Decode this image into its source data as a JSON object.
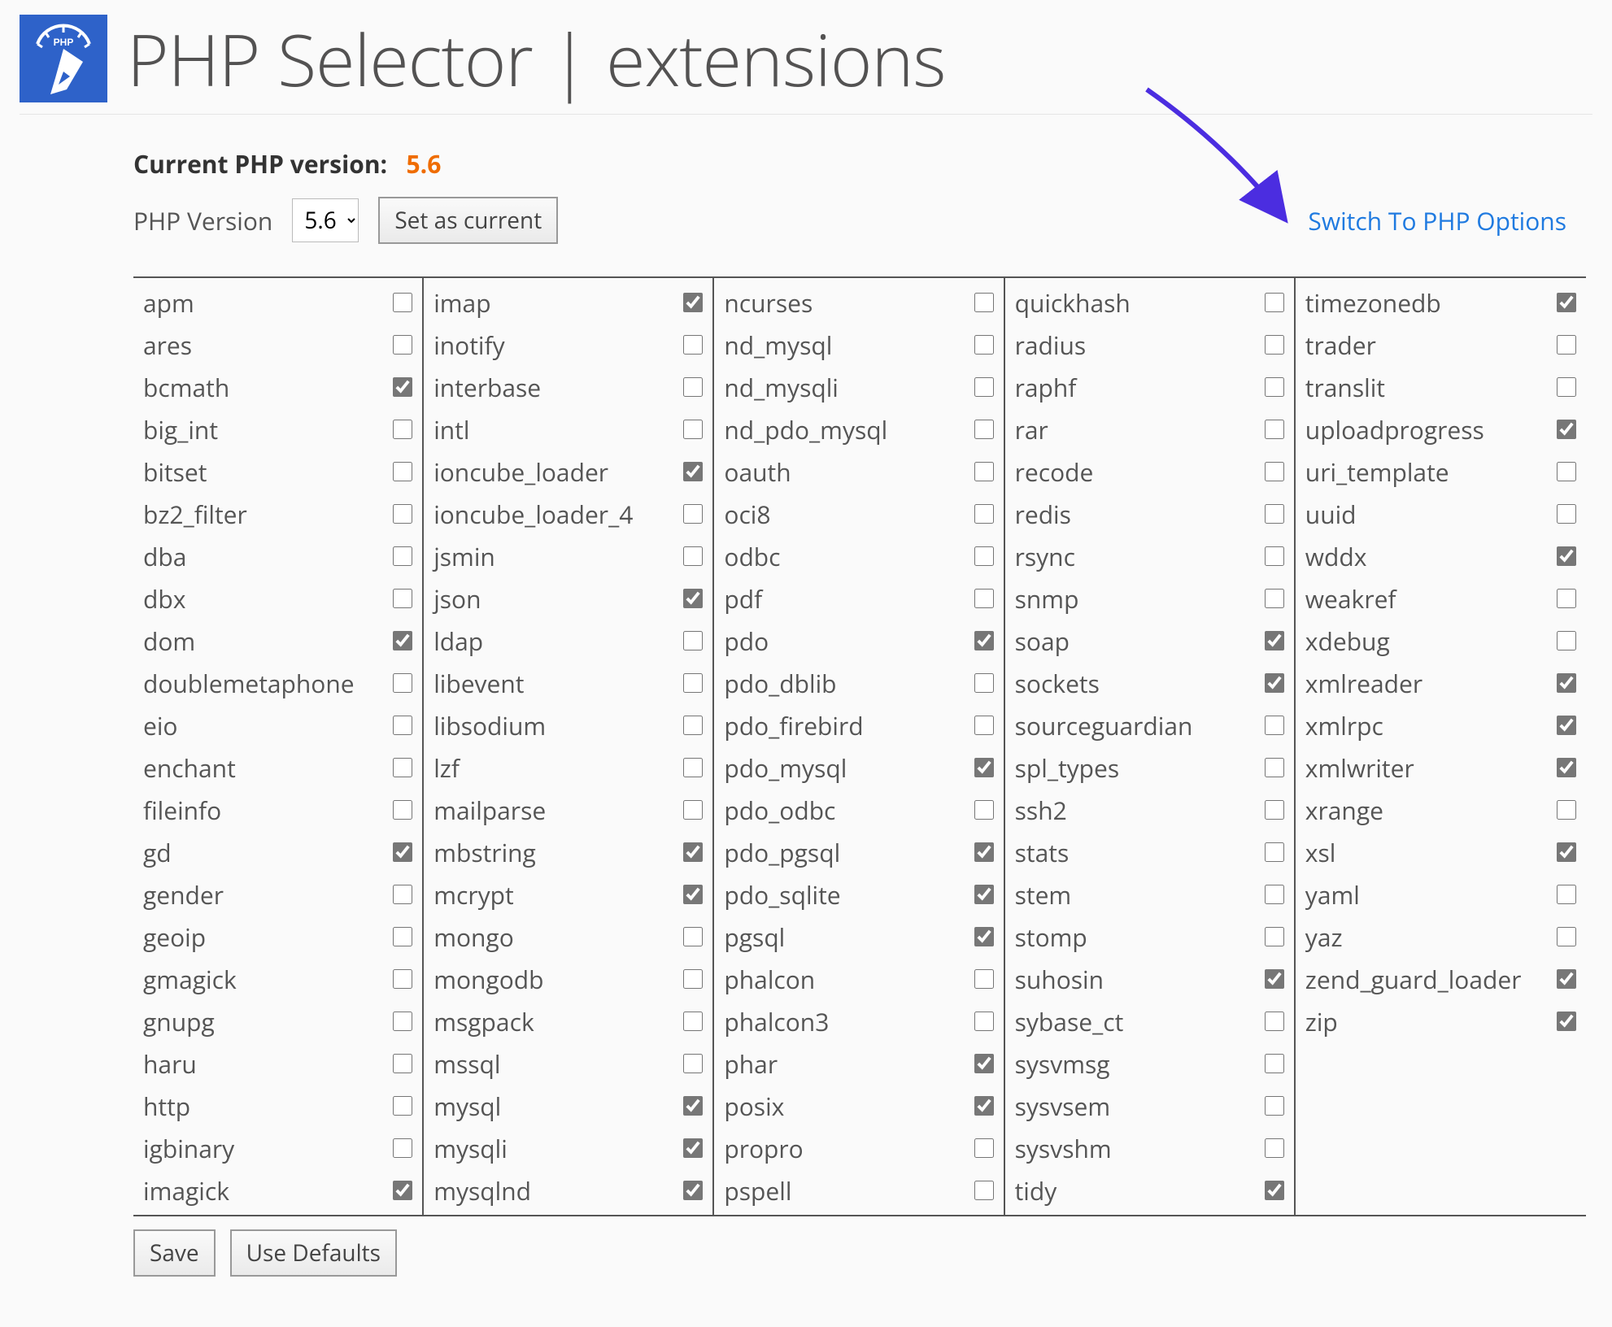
{
  "header": {
    "title": "PHP Selector | extensions"
  },
  "current": {
    "label": "Current PHP version:",
    "value": "5.6"
  },
  "versionRow": {
    "label": "PHP Version",
    "selected": "5.6",
    "setButton": "Set as current"
  },
  "switchLink": "Switch To PHP Options",
  "columns": [
    [
      {
        "name": "apm",
        "checked": false
      },
      {
        "name": "ares",
        "checked": false
      },
      {
        "name": "bcmath",
        "checked": true
      },
      {
        "name": "big_int",
        "checked": false
      },
      {
        "name": "bitset",
        "checked": false
      },
      {
        "name": "bz2_filter",
        "checked": false
      },
      {
        "name": "dba",
        "checked": false
      },
      {
        "name": "dbx",
        "checked": false
      },
      {
        "name": "dom",
        "checked": true
      },
      {
        "name": "doublemetaphone",
        "checked": false
      },
      {
        "name": "eio",
        "checked": false
      },
      {
        "name": "enchant",
        "checked": false
      },
      {
        "name": "fileinfo",
        "checked": false
      },
      {
        "name": "gd",
        "checked": true
      },
      {
        "name": "gender",
        "checked": false
      },
      {
        "name": "geoip",
        "checked": false
      },
      {
        "name": "gmagick",
        "checked": false
      },
      {
        "name": "gnupg",
        "checked": false
      },
      {
        "name": "haru",
        "checked": false
      },
      {
        "name": "http",
        "checked": false
      },
      {
        "name": "igbinary",
        "checked": false
      },
      {
        "name": "imagick",
        "checked": true
      }
    ],
    [
      {
        "name": "imap",
        "checked": true
      },
      {
        "name": "inotify",
        "checked": false
      },
      {
        "name": "interbase",
        "checked": false
      },
      {
        "name": "intl",
        "checked": false
      },
      {
        "name": "ioncube_loader",
        "checked": true
      },
      {
        "name": "ioncube_loader_4",
        "checked": false
      },
      {
        "name": "jsmin",
        "checked": false
      },
      {
        "name": "json",
        "checked": true
      },
      {
        "name": "ldap",
        "checked": false
      },
      {
        "name": "libevent",
        "checked": false
      },
      {
        "name": "libsodium",
        "checked": false
      },
      {
        "name": "lzf",
        "checked": false
      },
      {
        "name": "mailparse",
        "checked": false
      },
      {
        "name": "mbstring",
        "checked": true
      },
      {
        "name": "mcrypt",
        "checked": true
      },
      {
        "name": "mongo",
        "checked": false
      },
      {
        "name": "mongodb",
        "checked": false
      },
      {
        "name": "msgpack",
        "checked": false
      },
      {
        "name": "mssql",
        "checked": false
      },
      {
        "name": "mysql",
        "checked": true
      },
      {
        "name": "mysqli",
        "checked": true
      },
      {
        "name": "mysqlnd",
        "checked": true
      }
    ],
    [
      {
        "name": "ncurses",
        "checked": false
      },
      {
        "name": "nd_mysql",
        "checked": false
      },
      {
        "name": "nd_mysqli",
        "checked": false
      },
      {
        "name": "nd_pdo_mysql",
        "checked": false
      },
      {
        "name": "oauth",
        "checked": false
      },
      {
        "name": "oci8",
        "checked": false
      },
      {
        "name": "odbc",
        "checked": false
      },
      {
        "name": "pdf",
        "checked": false
      },
      {
        "name": "pdo",
        "checked": true
      },
      {
        "name": "pdo_dblib",
        "checked": false
      },
      {
        "name": "pdo_firebird",
        "checked": false
      },
      {
        "name": "pdo_mysql",
        "checked": true
      },
      {
        "name": "pdo_odbc",
        "checked": false
      },
      {
        "name": "pdo_pgsql",
        "checked": true
      },
      {
        "name": "pdo_sqlite",
        "checked": true
      },
      {
        "name": "pgsql",
        "checked": true
      },
      {
        "name": "phalcon",
        "checked": false
      },
      {
        "name": "phalcon3",
        "checked": false
      },
      {
        "name": "phar",
        "checked": true
      },
      {
        "name": "posix",
        "checked": true
      },
      {
        "name": "propro",
        "checked": false
      },
      {
        "name": "pspell",
        "checked": false
      }
    ],
    [
      {
        "name": "quickhash",
        "checked": false
      },
      {
        "name": "radius",
        "checked": false
      },
      {
        "name": "raphf",
        "checked": false
      },
      {
        "name": "rar",
        "checked": false
      },
      {
        "name": "recode",
        "checked": false
      },
      {
        "name": "redis",
        "checked": false
      },
      {
        "name": "rsync",
        "checked": false
      },
      {
        "name": "snmp",
        "checked": false
      },
      {
        "name": "soap",
        "checked": true
      },
      {
        "name": "sockets",
        "checked": true
      },
      {
        "name": "sourceguardian",
        "checked": false
      },
      {
        "name": "spl_types",
        "checked": false
      },
      {
        "name": "ssh2",
        "checked": false
      },
      {
        "name": "stats",
        "checked": false
      },
      {
        "name": "stem",
        "checked": false
      },
      {
        "name": "stomp",
        "checked": false
      },
      {
        "name": "suhosin",
        "checked": true
      },
      {
        "name": "sybase_ct",
        "checked": false
      },
      {
        "name": "sysvmsg",
        "checked": false
      },
      {
        "name": "sysvsem",
        "checked": false
      },
      {
        "name": "sysvshm",
        "checked": false
      },
      {
        "name": "tidy",
        "checked": true
      }
    ],
    [
      {
        "name": "timezonedb",
        "checked": true
      },
      {
        "name": "trader",
        "checked": false
      },
      {
        "name": "translit",
        "checked": false
      },
      {
        "name": "uploadprogress",
        "checked": true
      },
      {
        "name": "uri_template",
        "checked": false
      },
      {
        "name": "uuid",
        "checked": false
      },
      {
        "name": "wddx",
        "checked": true
      },
      {
        "name": "weakref",
        "checked": false
      },
      {
        "name": "xdebug",
        "checked": false
      },
      {
        "name": "xmlreader",
        "checked": true
      },
      {
        "name": "xmlrpc",
        "checked": true
      },
      {
        "name": "xmlwriter",
        "checked": true
      },
      {
        "name": "xrange",
        "checked": false
      },
      {
        "name": "xsl",
        "checked": true
      },
      {
        "name": "yaml",
        "checked": false
      },
      {
        "name": "yaz",
        "checked": false
      },
      {
        "name": "zend_guard_loader",
        "checked": true
      },
      {
        "name": "zip",
        "checked": true
      }
    ]
  ],
  "footer": {
    "save": "Save",
    "defaults": "Use Defaults"
  }
}
